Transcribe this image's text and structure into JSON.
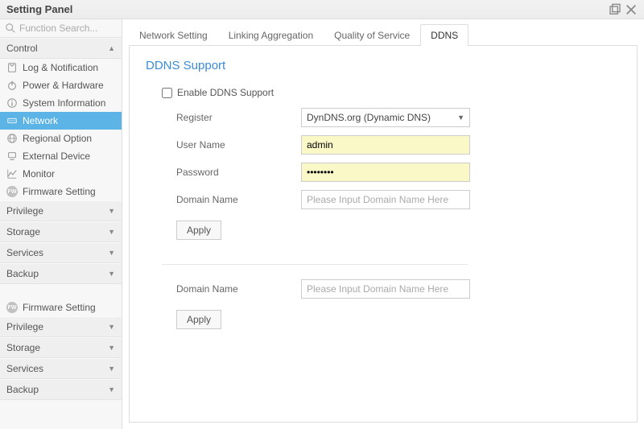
{
  "window": {
    "title": "Setting Panel"
  },
  "search": {
    "placeholder": "Function Search..."
  },
  "sidebar": {
    "headers": {
      "control": "Control",
      "privilege": "Privilege",
      "storage": "Storage",
      "services": "Services",
      "backup": "Backup"
    },
    "control_items": [
      {
        "label": "Log & Notification",
        "icon": "clipboard"
      },
      {
        "label": "Power & Hardware",
        "icon": "power"
      },
      {
        "label": "System Information",
        "icon": "info"
      },
      {
        "label": "Network",
        "icon": "network",
        "active": true
      },
      {
        "label": "Regional Option",
        "icon": "globe"
      },
      {
        "label": "External Device",
        "icon": "device"
      },
      {
        "label": "Monitor",
        "icon": "chart"
      },
      {
        "label": "Firmware Setting",
        "icon": "fw"
      }
    ],
    "repeat": {
      "firmware": "Firmware Setting",
      "privilege": "Privilege",
      "storage": "Storage",
      "services": "Services",
      "backup": "Backup"
    }
  },
  "tabs": [
    {
      "label": "Network Setting"
    },
    {
      "label": "Linking Aggregation"
    },
    {
      "label": "Quality of Service"
    },
    {
      "label": "DDNS",
      "active": true
    }
  ],
  "ddns": {
    "heading": "DDNS Support",
    "enable_label": "Enable DDNS Support",
    "register_label": "Register",
    "register_value": "DynDNS.org (Dynamic DNS)",
    "username_label": "User Name",
    "username_value": "admin",
    "password_label": "Password",
    "password_value": "••••••••",
    "domain_label": "Domain Name",
    "domain_placeholder": "Please Input Domain Name Here",
    "apply_label": "Apply"
  }
}
